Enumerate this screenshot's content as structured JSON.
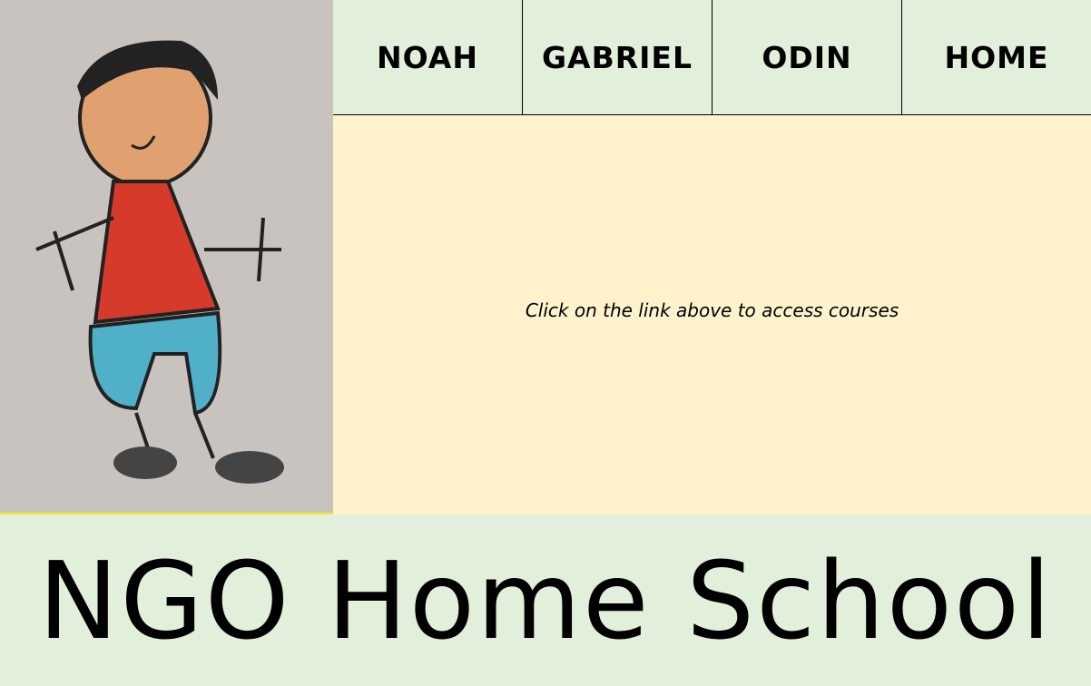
{
  "nav": {
    "items": [
      {
        "label": "NOAH"
      },
      {
        "label": "GABRIEL"
      },
      {
        "label": "ODIN"
      },
      {
        "label": "HOME"
      }
    ]
  },
  "main": {
    "message": "Click on the link above to access courses"
  },
  "footer": {
    "title": "NGO Home School"
  },
  "colors": {
    "nav_bg": "#e2efda",
    "main_bg": "#fff2cc",
    "accent_line": "#f5ee10"
  }
}
